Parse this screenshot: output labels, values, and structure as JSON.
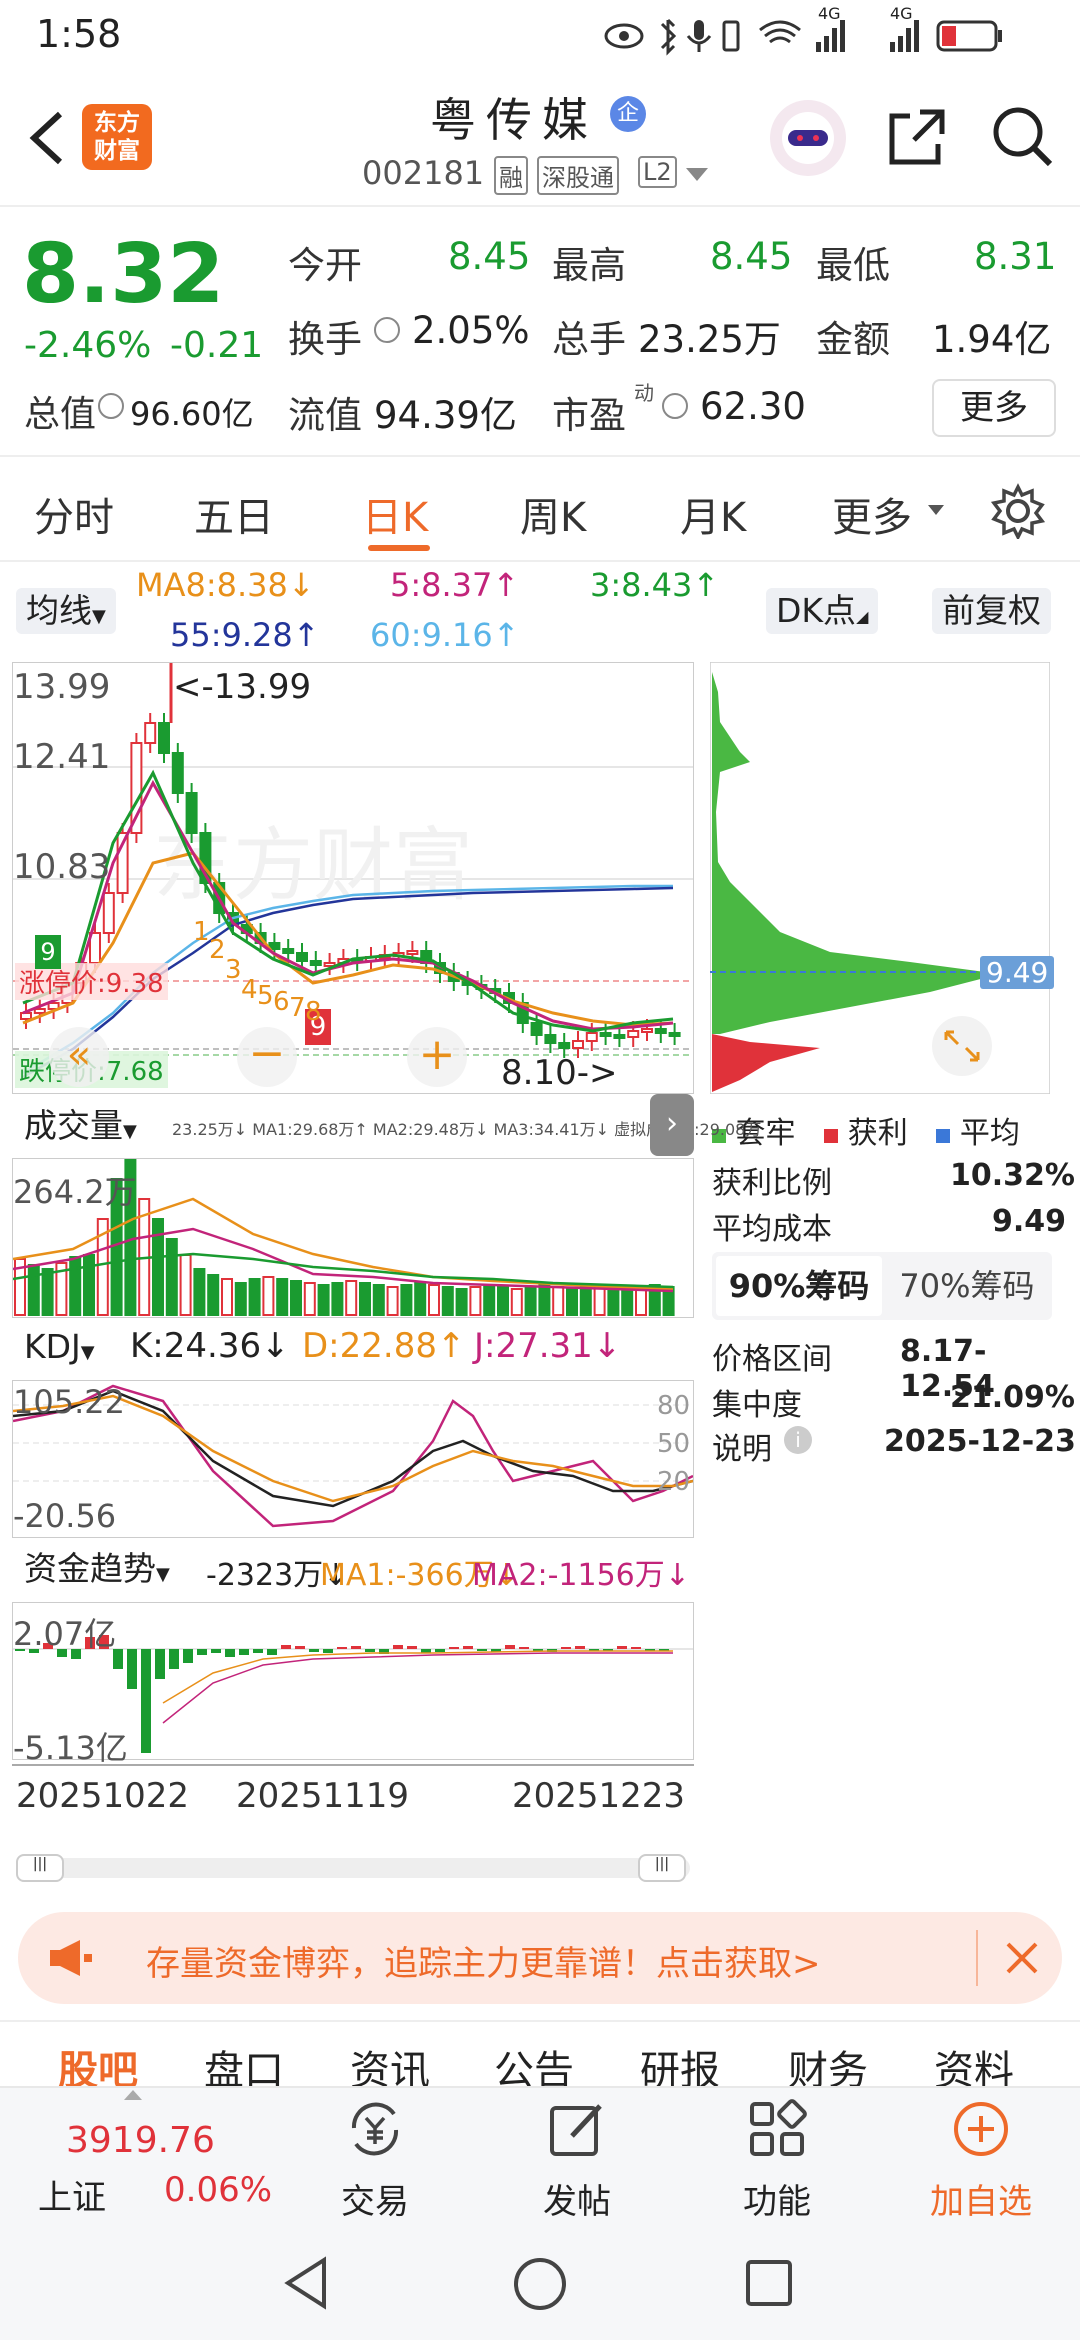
{
  "status_bar": {
    "time": "1:58",
    "network_1": "4G",
    "network_2": "4G"
  },
  "header": {
    "back_icon": "chevron-left-icon",
    "brand_badge": "东方\n财富",
    "stock_name": "粤传媒",
    "enterprise_badge": "企",
    "stock_code": "002181",
    "tags": [
      "融",
      "深股通",
      "L2"
    ],
    "share_icon": "share-icon",
    "search_icon": "search-icon"
  },
  "quote": {
    "price": "8.32",
    "change_pct": "-2.46%",
    "change": "-0.21",
    "total_value_label": "总值",
    "total_value": "96.60亿",
    "open_label": "今开",
    "open": "8.45",
    "high_label": "最高",
    "high": "8.45",
    "low_label": "最低",
    "low": "8.31",
    "turnover_label": "换手",
    "turnover": "2.05%",
    "volume_label": "总手",
    "volume": "23.25万",
    "amount_label": "金额",
    "amount": "1.94亿",
    "float_label": "流值",
    "float_value": "94.39亿",
    "pe_label": "市盈",
    "pe_sup": "动",
    "pe": "62.30",
    "more_button": "更多"
  },
  "tabs": {
    "items": [
      "分时",
      "五日",
      "日K",
      "周K",
      "月K",
      "更多"
    ],
    "active": "日K"
  },
  "ma_bar": {
    "selector": "均线",
    "ma8": "MA8:8.38↓",
    "ma5": "5:8.37↑",
    "ma3": "3:8.43↑",
    "ma55": "55:9.28↑",
    "ma60": "60:9.16↑",
    "dk_button": "DK点",
    "fq_button": "前复权"
  },
  "kline": {
    "y_max": "13.99",
    "y_mid1": "12.41",
    "y_mid2": "10.83",
    "max_note": "<-13.99",
    "min_note": "8.10->",
    "limit_up_label": "涨停价:9.38",
    "limit_down_label": "跌停价:7.68",
    "signal_9": "9",
    "signal_nums": [
      "1",
      "2",
      "3",
      "4",
      "5",
      "6",
      "7",
      "8"
    ],
    "watermark": "东方财富"
  },
  "chip_dist": {
    "avg_price": "9.49",
    "legend": [
      "套牢",
      "获利",
      "平均"
    ],
    "profit_ratio_label": "获利比例",
    "profit_ratio": "10.32%",
    "avg_cost_label": "平均成本",
    "avg_cost": "9.49",
    "tab_90": "90%筹码",
    "tab_70": "70%筹码",
    "price_range_label": "价格区间",
    "price_range": "8.17-12.54",
    "concentration_label": "集中度",
    "concentration": "21.09%",
    "note_label": "说明",
    "note_date": "2025-12-23",
    "colors": {
      "trapped": "#4ab843",
      "profit": "#e0323a",
      "average": "#3b78d8"
    }
  },
  "volume": {
    "selector": "成交量",
    "stats": "23.25万↓ MA1:29.68万↑ MA2:29.48万↓ MA3:34.41万↓ 虚拟成交量:29.08万",
    "y_max": "264.2万"
  },
  "kdj": {
    "selector": "KDJ",
    "k": "K:24.36↓",
    "d": "D:22.88↑",
    "j": "J:27.31↓",
    "y_max": "105.22",
    "y_min": "-20.56",
    "lvl_80": "80",
    "lvl_50": "50",
    "lvl_20": "20"
  },
  "fund": {
    "selector": "资金趋势",
    "value": "-2323万↓",
    "ma1": "MA1:-366万↓",
    "ma2": "MA2:-1156万↓",
    "y_max": "2.07亿",
    "y_min": "-5.13亿"
  },
  "x_dates": [
    "20251022",
    "20251119",
    "20251223"
  ],
  "banner": {
    "text": "存量资金博弈，追踪主力更靠谱！点击获取>",
    "icon": "megaphone-icon",
    "close_icon": "close-icon"
  },
  "sub_tabs": [
    "股吧",
    "盘口",
    "资讯",
    "公告",
    "研报",
    "财务",
    "资料"
  ],
  "bottom_nav": {
    "index_value": "3919.76",
    "index_name": "上证",
    "index_change": "0.06%",
    "items": [
      "交易",
      "发帖",
      "功能",
      "加自选"
    ]
  }
}
